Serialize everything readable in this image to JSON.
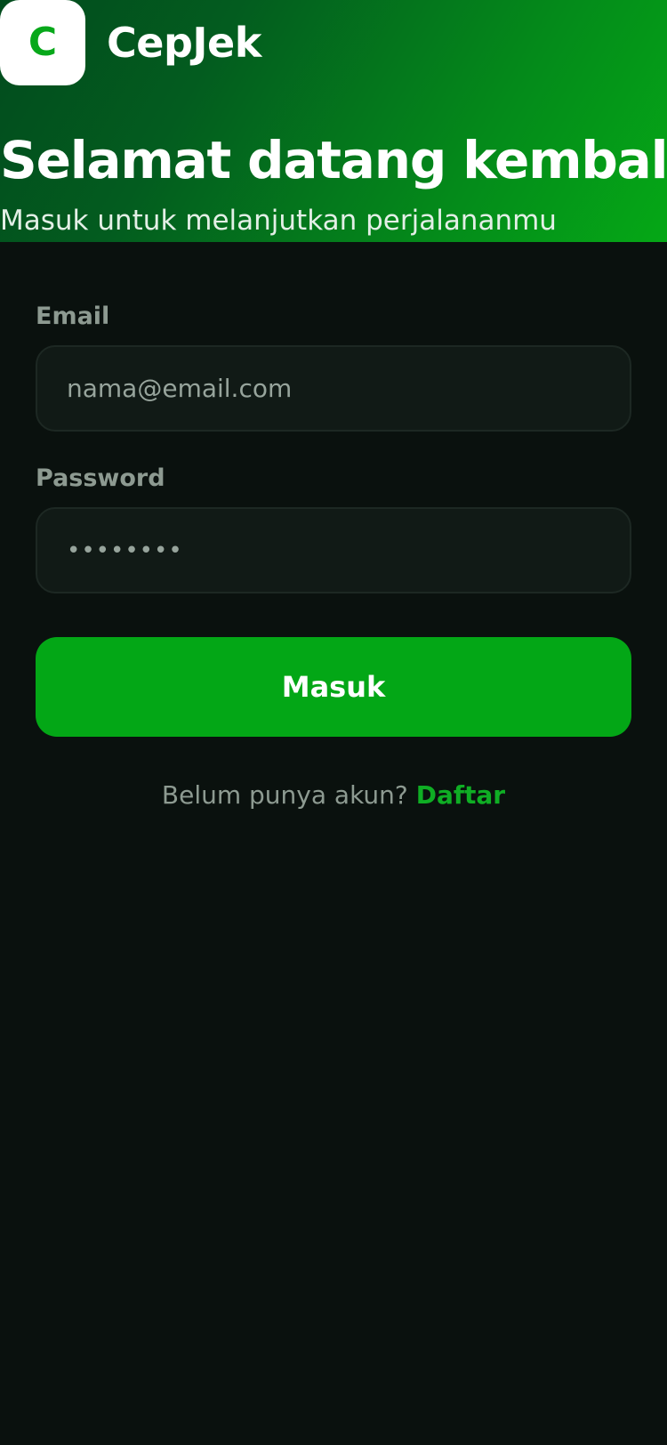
{
  "brand": {
    "logo_letter": "C",
    "name": "CepJek"
  },
  "hero": {
    "title": "Selamat datang kembali",
    "subtitle": "Masuk untuk melanjutkan perjalananmu"
  },
  "form": {
    "email_label": "Email",
    "email_placeholder": "nama@email.com",
    "password_label": "Password",
    "password_value": "••••••••",
    "submit_label": "Masuk"
  },
  "signup": {
    "prompt": "Belum punya akun?",
    "link_label": "Daftar"
  },
  "colors": {
    "accent": "#03a716",
    "background": "#0a110e",
    "input_background": "#111a16",
    "hero_gradient_start": "#024b1d",
    "hero_gradient_end": "#05a816"
  }
}
